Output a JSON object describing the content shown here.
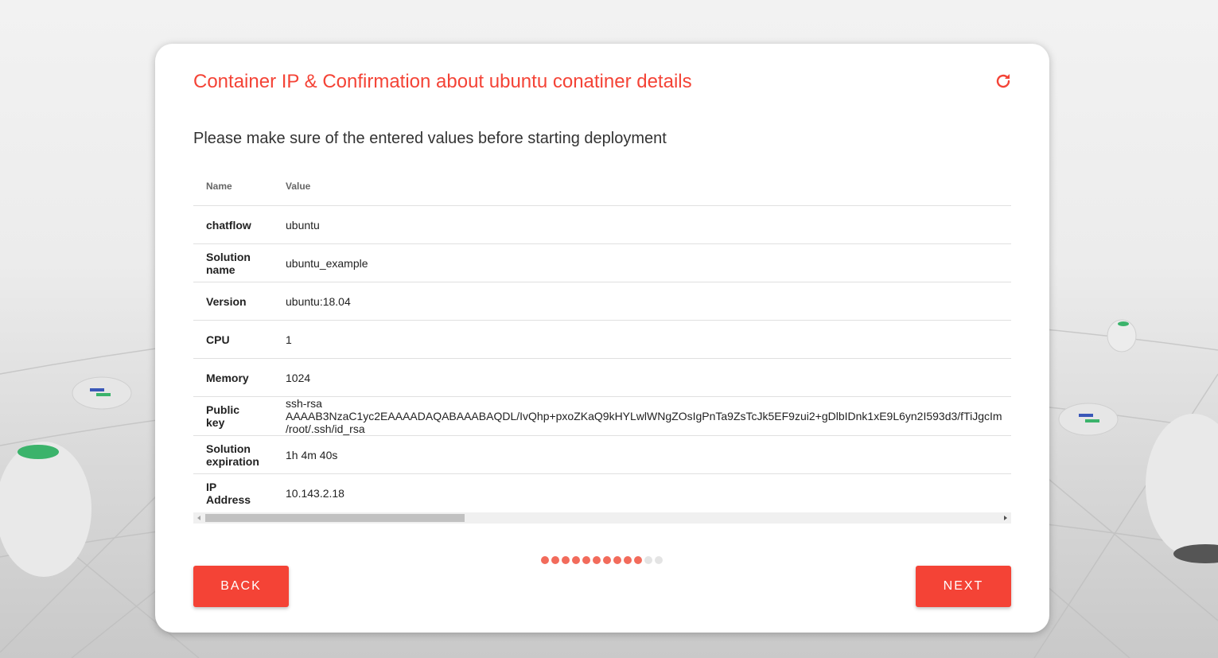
{
  "header": {
    "title": "Container IP & Confirmation about ubuntu conatiner details",
    "refresh_icon": "refresh-icon"
  },
  "main": {
    "subtitle": "Please make sure of the entered values before starting deployment",
    "table": {
      "columns": [
        "Name",
        "Value"
      ],
      "rows": [
        {
          "name": "chatflow",
          "value": "ubuntu"
        },
        {
          "name": "Solution name",
          "value": "ubuntu_example"
        },
        {
          "name": "Version",
          "value": "ubuntu:18.04"
        },
        {
          "name": "CPU",
          "value": "1"
        },
        {
          "name": "Memory",
          "value": "1024"
        },
        {
          "name": "Public key",
          "value_lines": [
            "ssh-rsa",
            "AAAAB3NzaC1yc2EAAAADAQABAAABAQDL/IvQhp+pxoZKaQ9kHYLwlWNgZOsIgPnTa9ZsTcJk5EF9zui2+gDlbIDnk1xE9L6yn2I593d3/fTiJgcIm",
            "/root/.ssh/id_rsa"
          ]
        },
        {
          "name": "Solution expiration",
          "value": "1h 4m 40s"
        },
        {
          "name": "IP Address",
          "value": "10.143.2.18"
        }
      ]
    }
  },
  "progress": {
    "total_steps": 12,
    "completed_steps": 10
  },
  "footer": {
    "back_label": "BACK",
    "next_label": "NEXT"
  },
  "colors": {
    "accent": "#f44336",
    "dot_active": "#f26b5b",
    "dot_inactive": "#e4e4e4"
  }
}
